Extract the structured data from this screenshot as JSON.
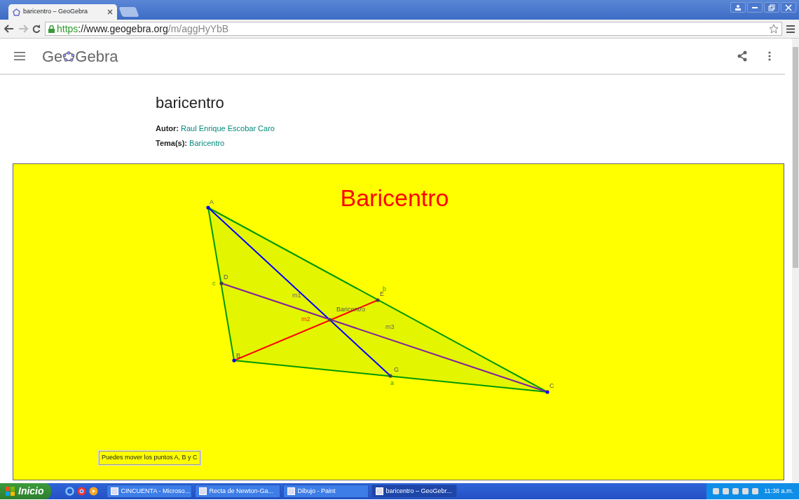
{
  "browser": {
    "tabs": [
      {
        "title": "baricentro – GeoGebra",
        "selected": true
      }
    ],
    "url": {
      "scheme": "https",
      "host": "://www.geogebra.org",
      "path": "/m/aggHyYbB"
    }
  },
  "header": {
    "logo_start": "Ge",
    "logo_end": "Gebra"
  },
  "material": {
    "title": "baricentro",
    "meta": [
      {
        "label": "Autor:",
        "value": "Raul Enrique Escobar Caro"
      },
      {
        "label": "Tema(s):",
        "value": "Baricentro"
      }
    ]
  },
  "applet": {
    "title": "Baricentro",
    "points": [
      {
        "label": "A",
        "color": "#0000ff"
      },
      {
        "label": "B",
        "color": "#0000ff"
      },
      {
        "label": "C",
        "color": "#0000ff"
      },
      {
        "label": "D",
        "color": "#444444"
      },
      {
        "label": "E",
        "color": "#444444"
      },
      {
        "label": "G",
        "color": "#444444"
      },
      {
        "label": "Baricentro",
        "color": "#444444"
      }
    ],
    "segments": [
      {
        "label": "a",
        "color": "#009900"
      },
      {
        "label": "b",
        "color": "#009900"
      },
      {
        "label": "c",
        "color": "#009900"
      },
      {
        "label": "m1",
        "color": "#0000ff"
      },
      {
        "label": "m2",
        "color": "#ff0000"
      },
      {
        "label": "m3",
        "color": "#7f1fa0"
      }
    ],
    "note": "Puedes mover los puntos A, B y C"
  },
  "taskbar": {
    "start": "Inicio",
    "tasks": [
      {
        "title": "CINCUENTA - Microso...",
        "selected": false
      },
      {
        "title": "Recta de Newton-Ga...",
        "selected": false
      },
      {
        "title": "Dibujo - Paint",
        "selected": false
      },
      {
        "title": "baricentro – GeoGebr...",
        "selected": true
      }
    ],
    "clock": "11:38 a.m."
  }
}
